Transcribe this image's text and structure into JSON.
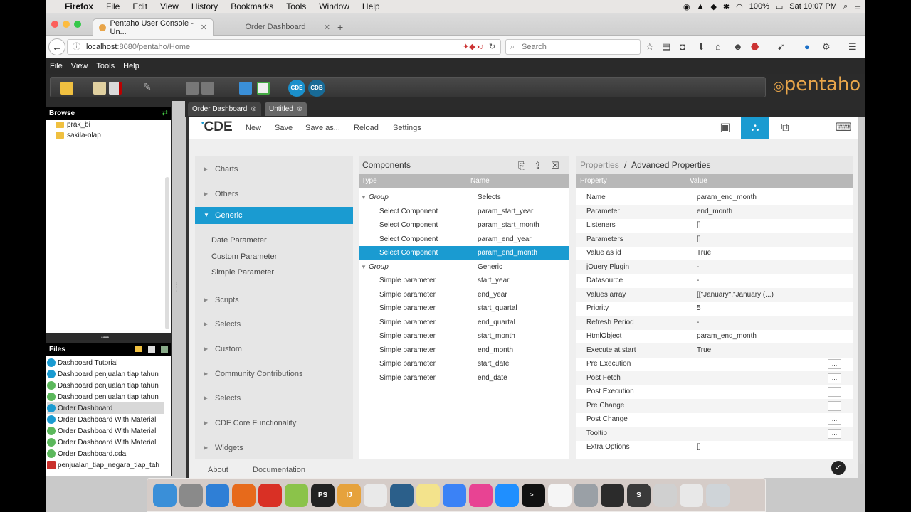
{
  "menubar": {
    "apple": "",
    "app": "Firefox",
    "items": [
      "File",
      "Edit",
      "View",
      "History",
      "Bookmarks",
      "Tools",
      "Window",
      "Help"
    ],
    "battery": "100%",
    "clock": "Sat 10:07 PM"
  },
  "browser": {
    "tabs": [
      "Pentaho User Console - Un...",
      "Order Dashboard"
    ],
    "url_host": "localhost",
    "url_rest": ":8080/pentaho/Home",
    "search_placeholder": "Search"
  },
  "pentaho": {
    "menu": [
      "File",
      "View",
      "Tools",
      "Help"
    ],
    "badges": [
      "CDE",
      "CDB"
    ],
    "logo": "pentaho"
  },
  "browse": {
    "title": "Browse",
    "folders": [
      "prak_bi",
      "sakila-olap"
    ]
  },
  "files": {
    "title": "Files",
    "items": [
      {
        "name": "Dashboard Tutorial",
        "kind": "CDE"
      },
      {
        "name": "Dashboard penjualan tiap tahun",
        "kind": "CDE"
      },
      {
        "name": "Dashboard penjualan tiap tahun",
        "kind": "CDA"
      },
      {
        "name": "Dashboard penjualan tiap tahun",
        "kind": "CDA"
      },
      {
        "name": "Order Dashboard",
        "kind": "CDE"
      },
      {
        "name": "Order Dashboard With Material I",
        "kind": "CDE"
      },
      {
        "name": "Order Dashboard With Material I",
        "kind": "CDA"
      },
      {
        "name": "Order Dashboard With Material I",
        "kind": "CDA"
      },
      {
        "name": "Order Dashboard.cda",
        "kind": "CDA"
      },
      {
        "name": "penjualan_tiap_negara_tiap_tah",
        "kind": "PDF"
      }
    ]
  },
  "doctabs": [
    "Order Dashboard",
    "Untitled"
  ],
  "cde": {
    "logo": "CDE",
    "menu": [
      "New",
      "Save",
      "Save as...",
      "Reload",
      "Settings"
    ],
    "categories_top": [
      "Charts",
      "Others",
      "Generic"
    ],
    "generic_items": [
      "Date Parameter",
      "Custom Parameter",
      "Simple Parameter"
    ],
    "categories_bottom": [
      "Scripts",
      "Selects",
      "Custom",
      "Community Contributions",
      "Selects",
      "CDF Core Functionality",
      "Widgets"
    ],
    "components": {
      "title": "Components",
      "col_type": "Type",
      "col_name": "Name",
      "rows": [
        {
          "type": "Group",
          "name": "Selects",
          "group": true
        },
        {
          "type": "Select Component",
          "name": "param_start_year"
        },
        {
          "type": "Select Component",
          "name": "param_start_month"
        },
        {
          "type": "Select Component",
          "name": "param_end_year"
        },
        {
          "type": "Select Component",
          "name": "param_end_month",
          "selected": true
        },
        {
          "type": "Group",
          "name": "Generic",
          "group": true
        },
        {
          "type": "Simple parameter",
          "name": "start_year"
        },
        {
          "type": "Simple parameter",
          "name": "end_year"
        },
        {
          "type": "Simple parameter",
          "name": "start_quartal"
        },
        {
          "type": "Simple parameter",
          "name": "end_quartal"
        },
        {
          "type": "Simple parameter",
          "name": "start_month"
        },
        {
          "type": "Simple parameter",
          "name": "end_month"
        },
        {
          "type": "Simple parameter",
          "name": "start_date"
        },
        {
          "type": "Simple parameter",
          "name": "end_date"
        }
      ]
    },
    "properties": {
      "crumb_left": "Properties",
      "crumb_sep": "/",
      "crumb_right": "Advanced Properties",
      "col_property": "Property",
      "col_value": "Value",
      "rows": [
        {
          "key": "Name",
          "value": "param_end_month"
        },
        {
          "key": "Parameter",
          "value": "end_month"
        },
        {
          "key": "Listeners",
          "value": "[]"
        },
        {
          "key": "Parameters",
          "value": "[]"
        },
        {
          "key": "Value as id",
          "value": "True"
        },
        {
          "key": "jQuery Plugin",
          "value": "-"
        },
        {
          "key": "Datasource",
          "value": "-"
        },
        {
          "key": "Values array",
          "value": "[[\"January\",\"January (...)"
        },
        {
          "key": "Priority",
          "value": "5"
        },
        {
          "key": "Refresh Period",
          "value": "-"
        },
        {
          "key": "HtmlObject",
          "value": "param_end_month"
        },
        {
          "key": "Execute at start",
          "value": "True"
        },
        {
          "key": "Pre Execution",
          "value": "",
          "button": "..."
        },
        {
          "key": "Post Fetch",
          "value": "",
          "button": "..."
        },
        {
          "key": "Post Execution",
          "value": "",
          "button": "..."
        },
        {
          "key": "Pre Change",
          "value": "",
          "button": "..."
        },
        {
          "key": "Post Change",
          "value": "",
          "button": "..."
        },
        {
          "key": "Tooltip",
          "value": "",
          "button": "..."
        },
        {
          "key": "Extra Options",
          "value": "[]"
        }
      ]
    },
    "footer": [
      "About",
      "Documentation"
    ]
  },
  "dock": {
    "apps": [
      "finder",
      "launchpad",
      "safari",
      "firefox",
      "chrome",
      "android-studio",
      "phpstorm",
      "intellij",
      "instruments",
      "sourcetree",
      "notes",
      "messenger",
      "itunes",
      "app-store",
      "terminal",
      "coffee",
      "system-preferences",
      "quicktime",
      "sublime-text",
      "preview",
      "documents",
      "trash"
    ],
    "labels": {
      "phpstorm": "PS",
      "intellij": "IJ",
      "terminal": ">_",
      "sublime-text": "S"
    }
  }
}
